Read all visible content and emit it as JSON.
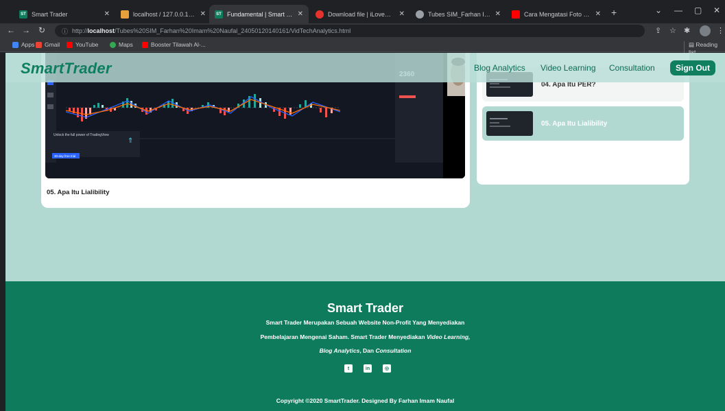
{
  "browser": {
    "tabs": [
      {
        "title": "Smart Trader",
        "favicon": "ST",
        "favicon_color": "#0e7c5c"
      },
      {
        "title": "localhost / 127.0.0.1 / smar",
        "favicon": "",
        "favicon_color": "#e8a03c"
      },
      {
        "title": "Fundamental | Smart Trader",
        "favicon": "ST",
        "favicon_color": "#0e7c5c"
      },
      {
        "title": "Download file | iLovePDF",
        "favicon": "",
        "favicon_color": "#e5322d"
      },
      {
        "title": "Tubes SIM_Farhan Imam N",
        "favicon": "",
        "favicon_color": "#9aa0a6"
      },
      {
        "title": "Cara Mengatasi Foto Scree",
        "favicon": "",
        "favicon_color": "#ff0000"
      }
    ],
    "url_prefix": "http://",
    "url_host": "localhost",
    "url_path": "/Tubes%20SIM_Farhan%20Imam%20Naufal_24050120140161/VidTechAnalytics.html",
    "bookmarks": [
      "Apps",
      "Gmail",
      "YouTube",
      "Maps",
      "Booster Tilawah Al-..."
    ],
    "reading_list": "Reading list"
  },
  "navbar": {
    "brand": "SmartTrader",
    "links": [
      "Blog Analytics",
      "Video Learning",
      "Consultation"
    ],
    "signout": "Sign Out"
  },
  "video": {
    "caption": "05. Apa Itu Lialibility",
    "ui_price": "2360",
    "ui_promo_title": "Unlock the full power of TradingView",
    "ui_promo_btn": "30-day free trial"
  },
  "playlist": {
    "items": [
      {
        "title": "04. Apa Itu PER?",
        "active": false
      },
      {
        "title": "05. Apa Itu Lialibility",
        "active": true
      }
    ]
  },
  "footer": {
    "title": "Smart Trader",
    "line1": "Smart Trader Merupakan Sebuah Website Non-Profit Yang Menyediakan",
    "line2_prefix": "Pembelajaran Mengenai Saham. Smart Trader Menyediakan ",
    "line2_em": "Video Learning,",
    "line3_em1": "Blog Analytics",
    "line3_mid": ", Dan ",
    "line3_em2": "Consultation",
    "copyright": "Copyright ©2020 SmartTrader. Designed By Farhan Imam Naufal",
    "social_icons": [
      "twitter-icon",
      "linkedin-icon",
      "instagram-icon"
    ]
  },
  "colors": {
    "brand_green": "#0e7c5c",
    "page_bg": "#b2d8d2"
  }
}
